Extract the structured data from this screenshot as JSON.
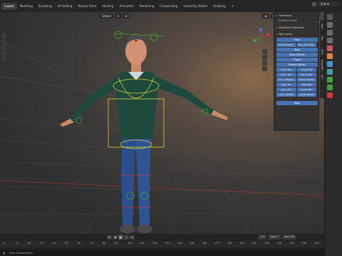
{
  "menubar": {
    "tabs": [
      "Layout",
      "Modeling",
      "Sculpting",
      "UV Editing",
      "Texture Paint",
      "Shading",
      "Animation",
      "Rendering",
      "Compositing",
      "Geometry Nodes",
      "Scripting",
      "+"
    ],
    "active_tab": "Layout",
    "scene_name": "Scene"
  },
  "viewport": {
    "header": {
      "orientation": "Global",
      "pose_options_label": "Pose Options"
    }
  },
  "sidebar": {
    "transform_header": "Transform",
    "no_bone_text": "No Bone Active",
    "rig_main_header": "Rig Main Properties",
    "rig_layers_header": "Rig Layers",
    "layers": {
      "face": "Face",
      "face_primary": "Face (Primary)",
      "face_secondary": "Face (Seconda...",
      "torso": "Torso",
      "torso_tweak": "Torso (Tweak)",
      "fingers": "Fingers",
      "fingers_detail": "Fingers (Detail)",
      "arm_l_ik": "Arm.L (IK)",
      "arm_r_ik": "Arm.R (IK)",
      "arm_l_fk": "Arm.L (FK)",
      "arm_r_fk": "Arm.R (FK)",
      "arm_l_tweak": "Arm.L (Tweak)",
      "arm_r_tweak": "Arm.R (Tweak)",
      "leg_l_ik": "Leg.L (IK)",
      "leg_r_ik": "Leg.R (IK)",
      "leg_l_fk": "Leg.L (FK)",
      "leg_r_fk": "Leg.R (FK)",
      "leg_l_tweak": "Leg.L (Tweak)",
      "leg_r_tweak": "Leg.R (Tweak)",
      "root": "Root"
    },
    "side_tabs": [
      "Item",
      "Tool",
      "View",
      "Animation",
      "ANT"
    ]
  },
  "timeline": {
    "current_frame": "174",
    "start_label": "Start",
    "start_value": "1",
    "end_label": "End",
    "end_value": "250",
    "ruler_ticks": [
      "0",
      "10",
      "20",
      "30",
      "40",
      "50",
      "60",
      "70",
      "80",
      "90",
      "100",
      "110",
      "120",
      "130",
      "140",
      "150",
      "160",
      "170",
      "180",
      "190",
      "200",
      "210",
      "220",
      "230",
      "240",
      "250"
    ]
  },
  "statusbar": {
    "text": "Pose Context Menu"
  },
  "colors": {
    "accent_blue": "#4772b3",
    "rig_yellow": "#d6d22f",
    "rig_green": "#3fa337",
    "rig_red": "#c83b3b"
  }
}
